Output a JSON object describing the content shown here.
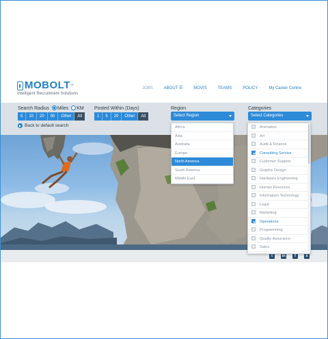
{
  "brand": {
    "name": "MOBOLT",
    "tm": "™",
    "tagline": "Intelligent Recruitment Solutions",
    "color": "#1f7fc7"
  },
  "nav": {
    "items": [
      {
        "label": "JOBS",
        "muted": true
      },
      {
        "label": "ABOUT",
        "icon": "menu-icon"
      },
      {
        "label": "MOVIS"
      },
      {
        "label": "TEAMS"
      },
      {
        "label": "POLICY"
      },
      {
        "label": "My Career Centre"
      }
    ]
  },
  "filters": {
    "search_radius": {
      "label": "Search Radius",
      "unit_miles": "Miles",
      "unit_km": "KM",
      "selected_unit": "Miles",
      "options": [
        "5",
        "10",
        "20",
        "50",
        "Other",
        "All"
      ]
    },
    "posted_within": {
      "label": "Posted Within (Days)",
      "options": [
        "1",
        "5",
        "20",
        "Other",
        "All"
      ]
    },
    "back_link": "Back to default search",
    "region": {
      "label": "Region",
      "placeholder": "Select Region",
      "options": [
        "Africa",
        "Asia",
        "Australia",
        "Europe",
        "North America",
        "South America",
        "Middle East"
      ],
      "highlighted": "North America"
    },
    "categories": {
      "label": "Categories",
      "placeholder": "Select Categories",
      "options": [
        {
          "label": "Animation",
          "checked": false
        },
        {
          "label": "Art",
          "checked": false
        },
        {
          "label": "Audit & Finance",
          "checked": false
        },
        {
          "label": "Consulting Service",
          "checked": true
        },
        {
          "label": "Customer Support",
          "checked": false
        },
        {
          "label": "Graphic Design",
          "checked": false
        },
        {
          "label": "Hardware Engineering",
          "checked": false
        },
        {
          "label": "Human Resouces",
          "checked": false
        },
        {
          "label": "Information Technology",
          "checked": false
        },
        {
          "label": "Legal",
          "checked": false
        },
        {
          "label": "Marketing",
          "checked": false
        },
        {
          "label": "Operations",
          "checked": true
        },
        {
          "label": "Programming",
          "checked": false
        },
        {
          "label": "Quality Assurance",
          "checked": false
        },
        {
          "label": "Sales",
          "checked": false
        }
      ]
    }
  },
  "footer": {
    "social": [
      {
        "icon": "twitter-icon",
        "glyph": "t"
      },
      {
        "icon": "linkedin-icon",
        "glyph": "in"
      },
      {
        "icon": "facebook-icon",
        "glyph": "f"
      },
      {
        "icon": "xing-icon",
        "glyph": "x"
      }
    ]
  }
}
